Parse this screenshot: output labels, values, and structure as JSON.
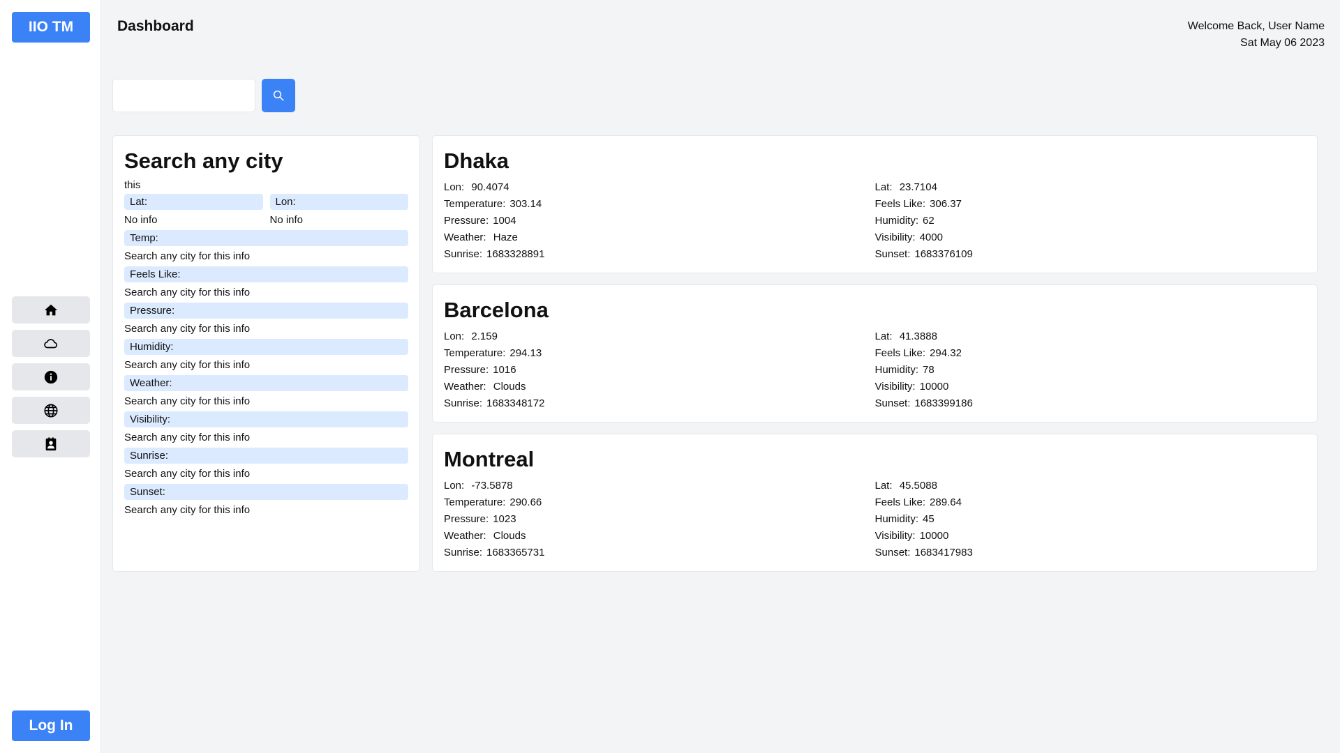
{
  "app": {
    "logo": "IIO TM",
    "login_label": "Log In"
  },
  "header": {
    "title": "Dashboard",
    "welcome": "Welcome Back, User Name",
    "date": "Sat May 06 2023"
  },
  "search": {
    "placeholder": "",
    "value": ""
  },
  "nav": [
    "home-icon",
    "cloud-icon",
    "info-icon",
    "globe-icon",
    "contact-icon"
  ],
  "search_panel": {
    "title": "Search any city",
    "subtitle": "this",
    "lat_label": "Lat:",
    "lon_label": "Lon:",
    "lat_value": "No info",
    "lon_value": "No info",
    "fields": [
      {
        "label": "Temp:",
        "value": "Search any city for this info"
      },
      {
        "label": "Feels Like:",
        "value": "Search any city for this info"
      },
      {
        "label": "Pressure:",
        "value": "Search any city for this info"
      },
      {
        "label": "Humidity:",
        "value": "Search any city for this info"
      },
      {
        "label": "Weather:",
        "value": "Search any city for this info"
      },
      {
        "label": "Visibility:",
        "value": "Search any city for this info"
      },
      {
        "label": "Sunrise:",
        "value": "Search any city for this info"
      },
      {
        "label": "Sunset:",
        "value": "Search any city for this info"
      }
    ]
  },
  "labels": {
    "lon": "Lon:",
    "lat": "Lat:",
    "temperature": "Temperature:",
    "feels_like": "Feels Like:",
    "pressure": "Pressure:",
    "humidity": "Humidity:",
    "weather": "Weather:",
    "visibility": "Visibility:",
    "sunrise": "Sunrise:",
    "sunset": "Sunset:"
  },
  "cities": [
    {
      "name": "Dhaka",
      "lon": "90.4074",
      "lat": "23.7104",
      "temperature": "303.14",
      "feels_like": "306.37",
      "pressure": "1004",
      "humidity": "62",
      "weather": "Haze",
      "visibility": "4000",
      "sunrise": "1683328891",
      "sunset": "1683376109"
    },
    {
      "name": "Barcelona",
      "lon": "2.159",
      "lat": "41.3888",
      "temperature": "294.13",
      "feels_like": "294.32",
      "pressure": "1016",
      "humidity": "78",
      "weather": "Clouds",
      "visibility": "10000",
      "sunrise": "1683348172",
      "sunset": "1683399186"
    },
    {
      "name": "Montreal",
      "lon": "-73.5878",
      "lat": "45.5088",
      "temperature": "290.66",
      "feels_like": "289.64",
      "pressure": "1023",
      "humidity": "45",
      "weather": "Clouds",
      "visibility": "10000",
      "sunrise": "1683365731",
      "sunset": "1683417983"
    }
  ]
}
